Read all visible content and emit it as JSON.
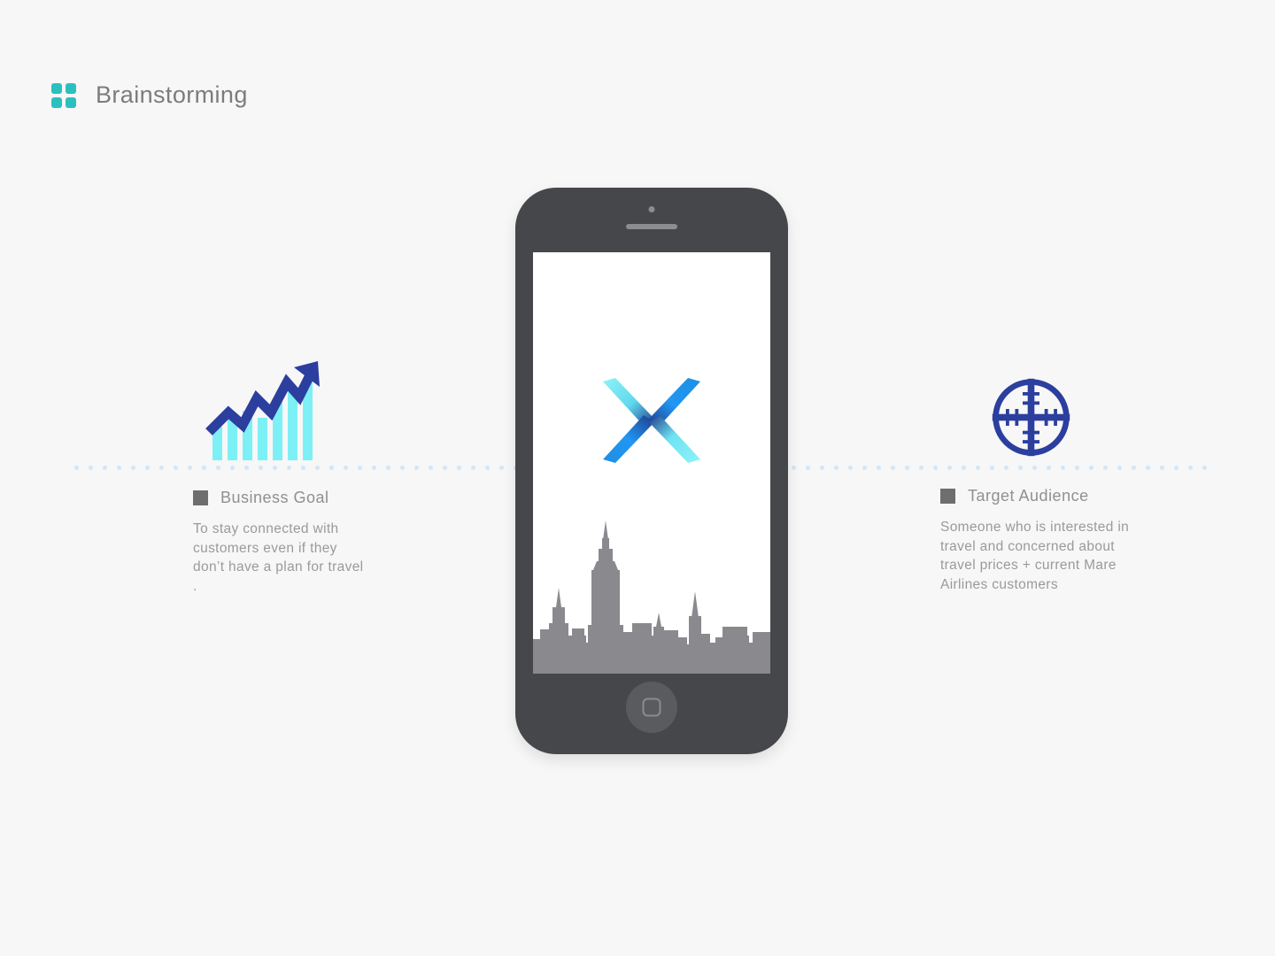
{
  "header": {
    "title": "Brainstorming",
    "logo_icon": "four-squares-grid-icon",
    "logo_color": "#2CBFC0"
  },
  "theme": {
    "background": "#F7F7F7",
    "title_color": "#7C7C7C",
    "panel_title_color": "#909090",
    "panel_body_color": "#9A9A9A",
    "bullet_color": "#6E6E6E",
    "dot_color": "#D4E6F5",
    "phone_body": "#46474B",
    "phone_screen": "#FFFFFF",
    "accent_cyan": "#7DF0F5",
    "accent_blue": "#1E8FE3",
    "accent_navy": "#2C3E9E",
    "skyline_gray": "#8A8A8E"
  },
  "panels": [
    {
      "id": "business-goal",
      "bullet_icon": "square-bullet-icon",
      "title": "Business Goal",
      "body": "To stay connected with customers even if they don’t have a plan for travel ."
    },
    {
      "id": "target-audience",
      "bullet_icon": "square-bullet-icon",
      "title": "Target Audience",
      "body": "Someone who is interested in travel and concerned about travel prices + current Mare Airlines customers"
    }
  ],
  "icons": {
    "left": "growth-bar-chart-arrow-icon",
    "right": "crosshair-target-scope-icon"
  },
  "phone": {
    "device_icon": "smartphone-mockup",
    "camera_icon": "front-camera-icon",
    "speaker_icon": "earpiece-speaker-icon",
    "home_button_icon": "home-button-icon",
    "screen": {
      "app_logo_icon": "x-ribbon-logo-icon",
      "illustration_icon": "new-york-city-skyline-silhouette"
    }
  },
  "divider": {
    "icon": "dotted-horizontal-rule",
    "dot_spacing_px": 16
  }
}
